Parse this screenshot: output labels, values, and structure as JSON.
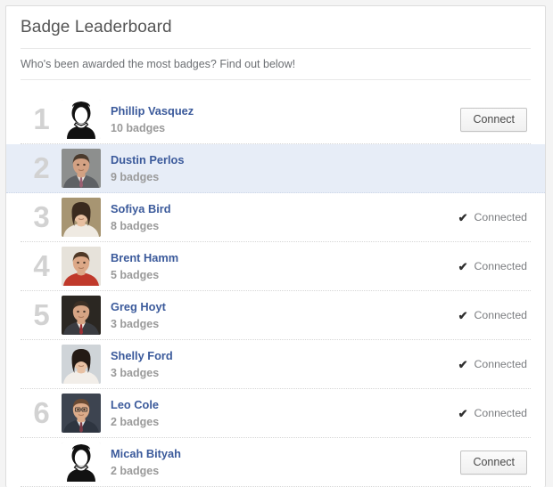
{
  "panel": {
    "title": "Badge Leaderboard",
    "subtitle": "Who's been awarded the most badges? Find out below!"
  },
  "actions": {
    "connect_label": "Connect",
    "connected_label": "Connected",
    "check_glyph": "✔"
  },
  "colors": {
    "name_link": "#3b5a9b",
    "rank": "#d2d2d2",
    "badge_text": "#9a9a9a",
    "highlight_row": "#e7edf7",
    "card_border": "#dddddd"
  },
  "leaderboard": [
    {
      "rank": "1",
      "name": "Phillip Vasquez",
      "badges": "10 badges",
      "action": "connect",
      "avatar": "silhouette",
      "highlight": false
    },
    {
      "rank": "2",
      "name": "Dustin Perlos",
      "badges": "9 badges",
      "action": "none",
      "avatar": "photo-man-suit-gray",
      "highlight": true
    },
    {
      "rank": "3",
      "name": "Sofiya Bird",
      "badges": "8 badges",
      "action": "connected",
      "avatar": "photo-woman-tan",
      "highlight": false
    },
    {
      "rank": "4",
      "name": "Brent Hamm",
      "badges": "5 badges",
      "action": "connected",
      "avatar": "photo-man-red-shirt",
      "highlight": false
    },
    {
      "rank": "5",
      "name": "Greg Hoyt",
      "badges": "3 badges",
      "action": "connected",
      "avatar": "photo-man-dark-suit",
      "highlight": false
    },
    {
      "rank": "",
      "name": "Shelly Ford",
      "badges": "3 badges",
      "action": "connected",
      "avatar": "photo-woman-dark-hair",
      "highlight": false
    },
    {
      "rank": "6",
      "name": "Leo Cole",
      "badges": "2 badges",
      "action": "connected",
      "avatar": "photo-man-glasses",
      "highlight": false
    },
    {
      "rank": "",
      "name": "Micah Bityah",
      "badges": "2 badges",
      "action": "connect",
      "avatar": "silhouette",
      "highlight": false
    }
  ]
}
